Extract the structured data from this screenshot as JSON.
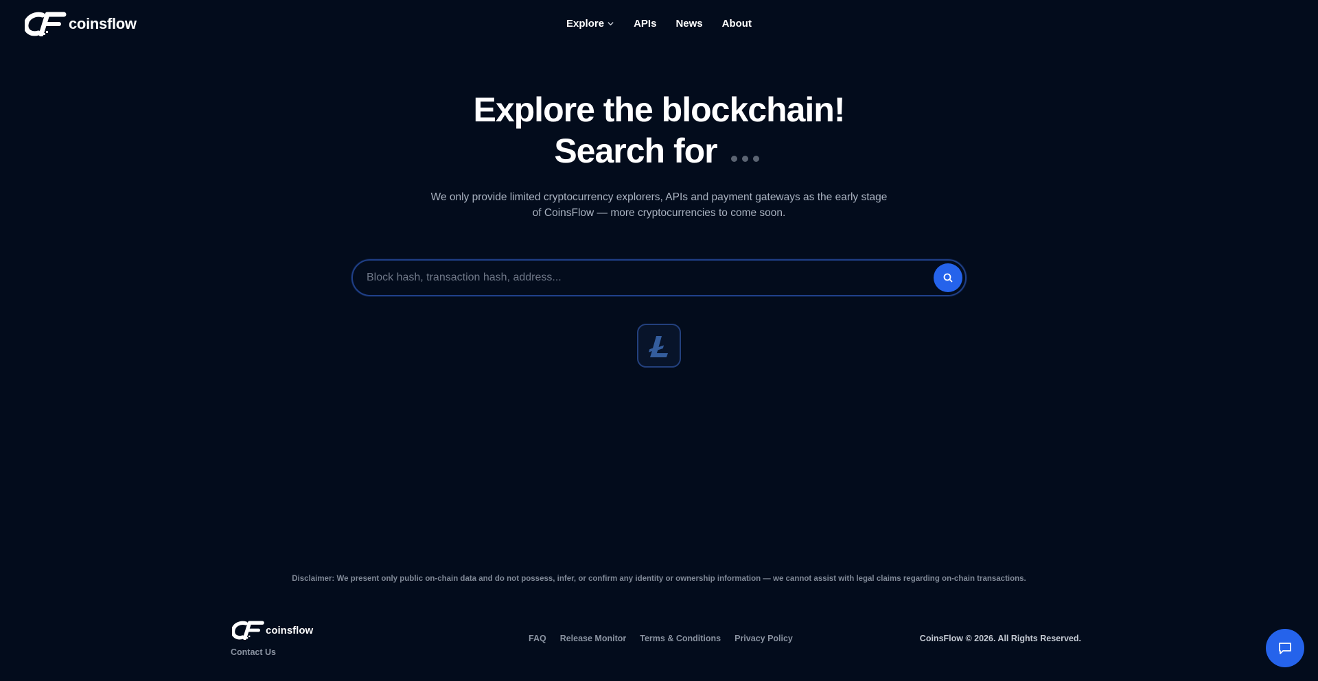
{
  "brand": {
    "name": "coinsflow"
  },
  "nav": {
    "items": [
      {
        "label": "Explore"
      },
      {
        "label": "APIs"
      },
      {
        "label": "News"
      },
      {
        "label": "About"
      }
    ]
  },
  "hero": {
    "title": "Explore the blockchain!",
    "line2": "Search for",
    "subtitle": "We only provide limited cryptocurrency explorers, APIs and payment gateways as the early stage of CoinsFlow — more cryptocurrencies to come soon."
  },
  "search": {
    "placeholder": "Block hash, transaction hash, address...",
    "value": ""
  },
  "coins": [
    {
      "icon": "litecoin-icon",
      "color": "#345d9d"
    }
  ],
  "footer": {
    "disclaimer": "Disclaimer: We present only public on-chain data and do not possess, infer, or confirm any identity or ownership information — we cannot assist with legal claims regarding on-chain transactions.",
    "contact": "Contact Us",
    "links": [
      "FAQ",
      "Release Monitor",
      "Terms & Conditions",
      "Privacy Policy"
    ],
    "copyright": "CoinsFlow © 2026. All Rights Reserved."
  },
  "colors": {
    "background": "#030c1c",
    "accent": "#2563eb",
    "muted_text": "#a9b2c0"
  }
}
